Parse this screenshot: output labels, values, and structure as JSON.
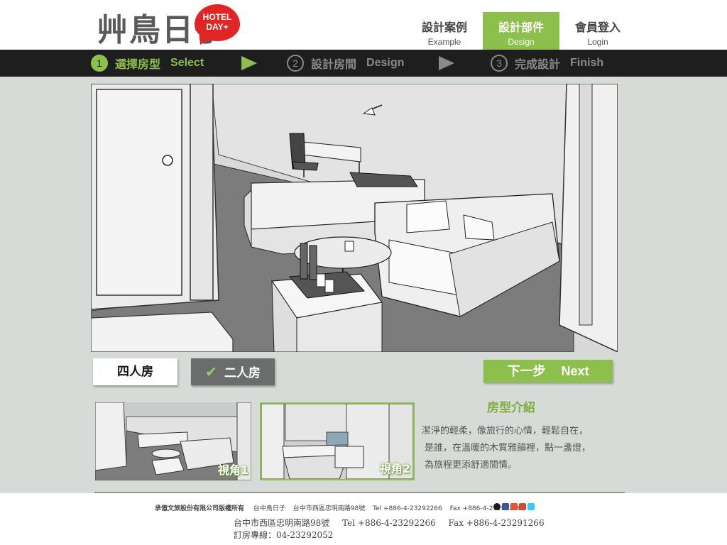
{
  "brand": {
    "logo_text": "艸鳥日子",
    "badge_line1": "HOTEL",
    "badge_line2": "DAY+"
  },
  "nav": [
    {
      "zh": "設計案例",
      "en": "Example",
      "active": false
    },
    {
      "zh": "設計部件",
      "en": "Design",
      "active": true
    },
    {
      "zh": "會員登入",
      "en": "Login",
      "active": false
    }
  ],
  "steps": [
    {
      "num": "1",
      "zh": "選擇房型",
      "en": "Select",
      "active": true
    },
    {
      "num": "2",
      "zh": "設計房間",
      "en": "Design",
      "active": false
    },
    {
      "num": "3",
      "zh": "完成設計",
      "en": "Finish",
      "active": false
    }
  ],
  "room_types": {
    "four": "四人房",
    "two": "二人房",
    "selected": "二人房"
  },
  "next": {
    "zh": "下一步",
    "en": "Next"
  },
  "thumbs": [
    {
      "label": "視角1"
    },
    {
      "label": "視角2"
    }
  ],
  "intro": {
    "title": "房型介紹",
    "lines": [
      "潔淨的輕柔，像旅行的心情，輕鬆自在，",
      "是誰，在溫暖的木質雅韻裡，點一盞燈，",
      "為旅程更添舒適閒情。"
    ]
  },
  "footer": {
    "company": "承億文旅股份有限公司版權所有",
    "brand": "台中鳥日子",
    "address": "台中市西區忠明南路98號",
    "tel": "Tel +886-4-23292266",
    "fax": "Fax +886-4-23291266",
    "line2_address": "台中市西區忠明南路98號",
    "line2_tel": "Tel +886-4-23292266",
    "line2_fax": "Fax +886-4-23291266",
    "booking": "訂房專線：04-23292052"
  },
  "colors": {
    "accent": "#8dbf4c",
    "dark_bar": "#1e1e1e",
    "content_bg": "#d6dbd8",
    "logo_red": "#e02525"
  },
  "icons": [
    "check-icon",
    "arrow-right-icon",
    "tripadvisor-icon",
    "facebook-icon",
    "plurk-icon",
    "googleplus-icon",
    "twitter-icon"
  ]
}
